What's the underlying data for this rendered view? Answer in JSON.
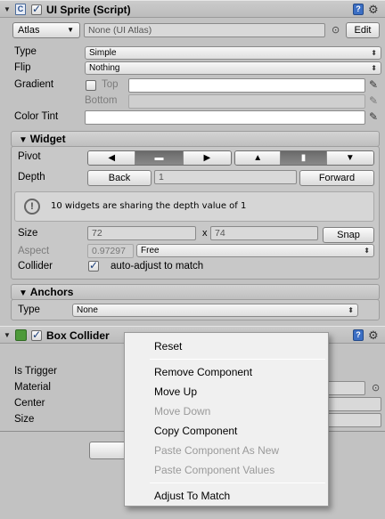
{
  "ui_sprite": {
    "title": "UI Sprite (Script)",
    "atlas_button": "Atlas",
    "atlas_value": "None (UI Atlas)",
    "edit_button": "Edit",
    "type_label": "Type",
    "type_value": "Simple",
    "flip_label": "Flip",
    "flip_value": "Nothing",
    "gradient_label": "Gradient",
    "gradient_top": "Top",
    "gradient_bottom": "Bottom",
    "color_tint_label": "Color Tint",
    "colors": {
      "accent": "#3c6fc4",
      "panel": "#c2c2c2"
    }
  },
  "widget": {
    "title": "Widget",
    "pivot_label": "Pivot",
    "depth_label": "Depth",
    "back_button": "Back",
    "depth_value": "1",
    "forward_button": "Forward",
    "info_text": "10 widgets are sharing the depth value of 1",
    "size_label": "Size",
    "size_x": "72",
    "size_sep": "x",
    "size_y": "74",
    "snap_button": "Snap",
    "aspect_label": "Aspect",
    "aspect_value": "0.97297",
    "aspect_mode": "Free",
    "collider_label": "Collider",
    "collider_text": "auto-adjust to match"
  },
  "anchors": {
    "title": "Anchors",
    "type_label": "Type",
    "type_value": "None"
  },
  "box_collider": {
    "title": "Box Collider",
    "is_trigger_label": "Is Trigger",
    "material_label": "Material",
    "center_label": "Center",
    "size_label": "Size"
  },
  "context_menu": {
    "items": [
      {
        "label": "Reset",
        "enabled": true
      },
      {
        "label": "Remove Component",
        "enabled": true
      },
      {
        "label": "Move Up",
        "enabled": true
      },
      {
        "label": "Move Down",
        "enabled": false
      },
      {
        "label": "Copy Component",
        "enabled": true
      },
      {
        "label": "Paste Component As New",
        "enabled": false
      },
      {
        "label": "Paste Component Values",
        "enabled": false
      },
      {
        "label": "Adjust To Match",
        "enabled": true
      }
    ]
  }
}
